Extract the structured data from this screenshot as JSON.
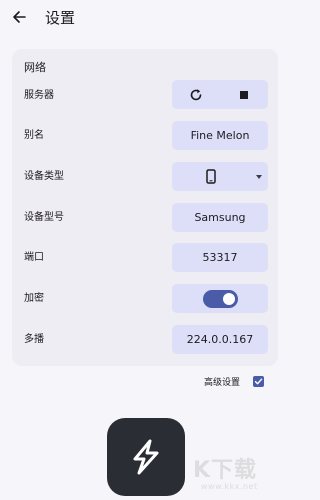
{
  "header": {
    "title": "设置",
    "back_icon": "arrow-left-icon"
  },
  "network": {
    "section_title": "网络",
    "server": {
      "label": "服务器",
      "refresh_icon": "refresh-icon",
      "stop_icon": "stop-icon"
    },
    "alias": {
      "label": "别名",
      "value": "Fine Melon"
    },
    "device_type": {
      "label": "设备类型",
      "icon": "smartphone-icon",
      "dropdown_icon": "chevron-down-icon"
    },
    "device_model": {
      "label": "设备型号",
      "value": "Samsung"
    },
    "port": {
      "label": "端口",
      "value": "53317"
    },
    "encryption": {
      "label": "加密",
      "enabled": true
    },
    "multicast": {
      "label": "多播",
      "value": "224.0.0.167"
    }
  },
  "advanced": {
    "label": "高级设置",
    "checked": true
  },
  "watermark": {
    "text": "K下载",
    "url": "www.kkx.net"
  },
  "colors": {
    "background": "#f6f5fa",
    "card": "#eeedf3",
    "control": "#dddff8",
    "accent": "#4a5ca8",
    "logo_bg": "#2a2d33"
  }
}
